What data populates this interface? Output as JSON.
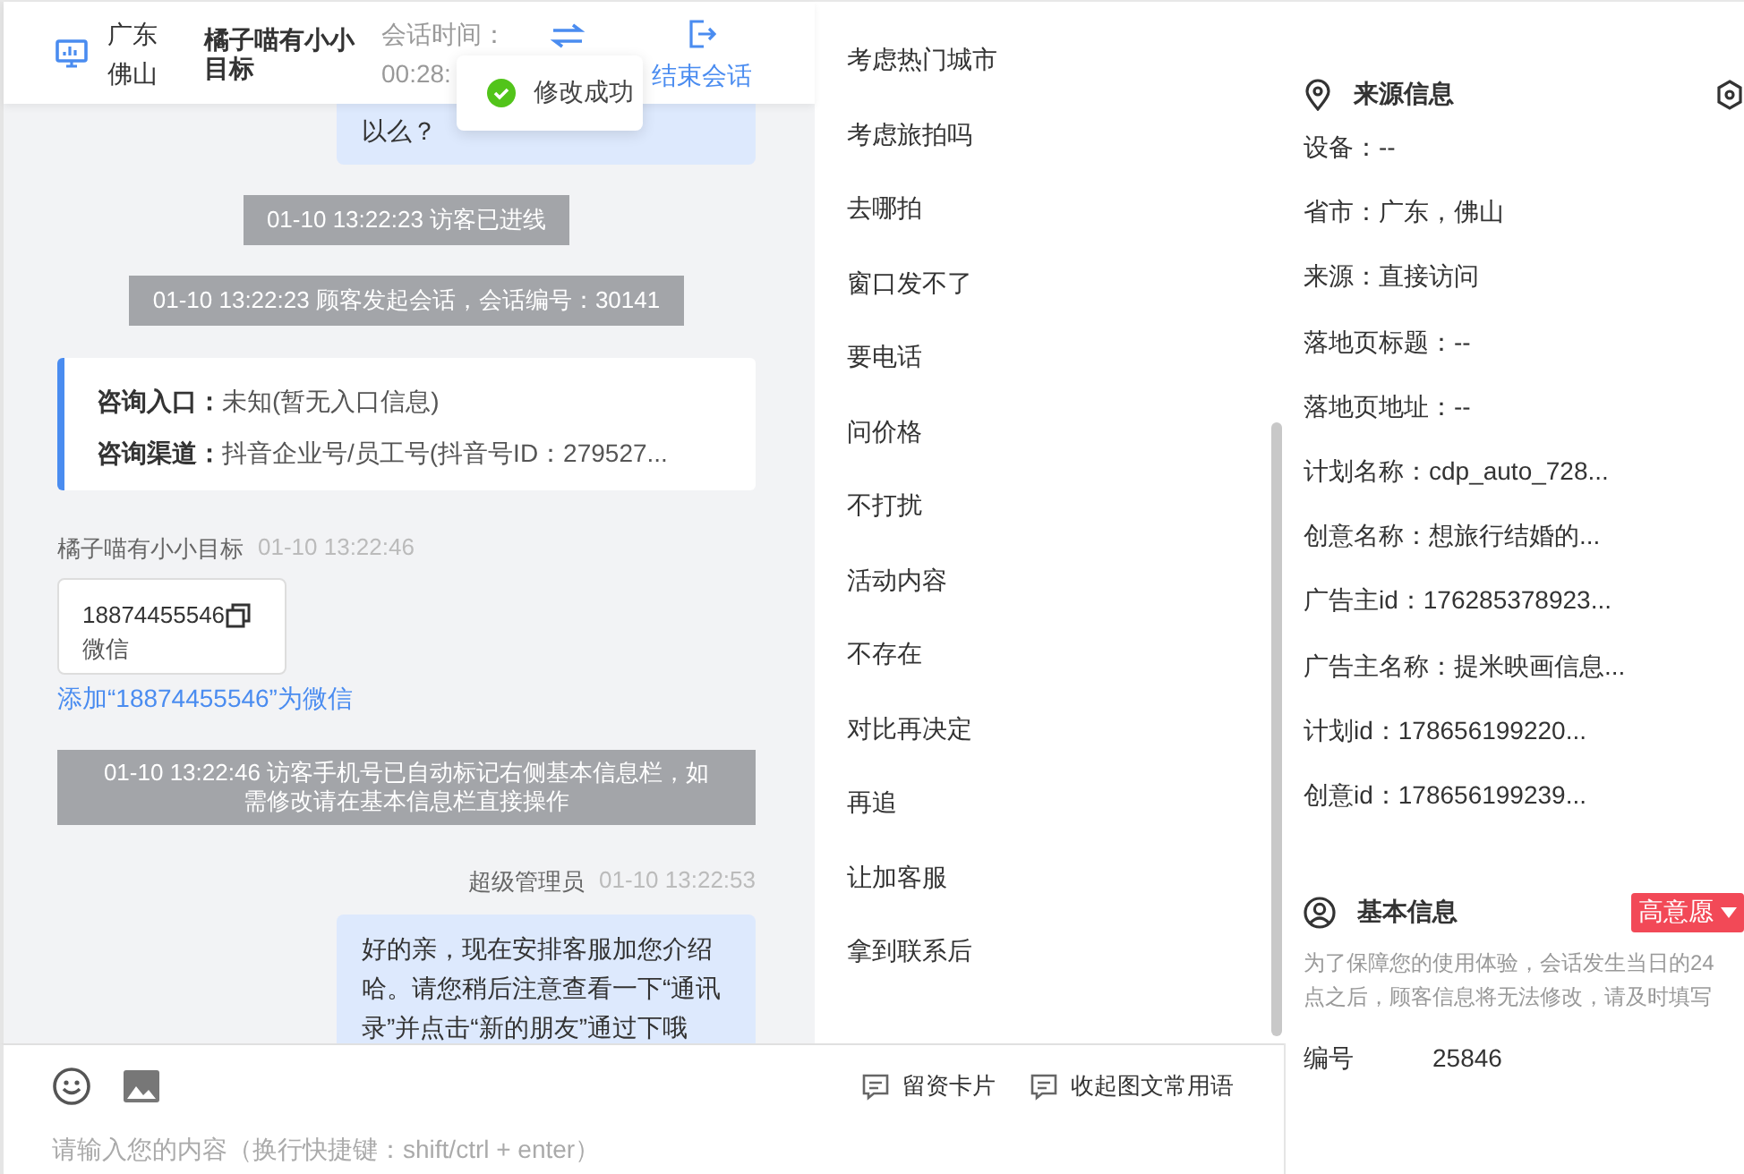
{
  "header": {
    "location": [
      "广东",
      "佛山"
    ],
    "visitor_name": "橘子喵有小小目标",
    "session_time_label": "会话时间：",
    "session_time": "00:28:",
    "end_button": "结束会话"
  },
  "toast": {
    "kind": "success",
    "text": "修改成功"
  },
  "messages": [
    {
      "kind": "bubble",
      "text": "以么？"
    },
    {
      "kind": "system",
      "text": "01-10 13:22:23 访客已进线"
    },
    {
      "kind": "system",
      "text": "01-10 13:22:23 顾客发起会话，会话编号：30141"
    },
    {
      "kind": "info_card",
      "rows": [
        {
          "label": "咨询入口：",
          "value": "未知(暂无入口信息)"
        },
        {
          "label": "咨询渠道：",
          "value": "抖音企业号/员工号(抖音号ID：279527..."
        }
      ]
    },
    {
      "kind": "visitor_meta",
      "sender": "橘子喵有小小目标",
      "time": "01-10 13:22:46"
    },
    {
      "kind": "contact_card",
      "number": "18874455546",
      "type": "微信"
    },
    {
      "kind": "link",
      "text": "添加“18874455546”为微信"
    },
    {
      "kind": "notice",
      "text": "01-10 13:22:46 访客手机号已自动标记右侧基本信息栏，如需修改请在基本信息栏直接操作"
    },
    {
      "kind": "agent_meta",
      "sender": "超级管理员",
      "time": "01-10 13:22:53"
    },
    {
      "kind": "bubble",
      "text": "好的亲，现在安排客服加您介绍哈。请您稍后注意查看一下“通讯录”并点击“新的朋友”通过下哦"
    }
  ],
  "composer": {
    "tools": [
      "留资卡片",
      "收起图文常用语"
    ],
    "placeholder": "请输入您的内容（换行快捷键：shift/ctrl + enter）"
  },
  "quick_replies": [
    "考虑热门城市",
    "考虑旅拍吗",
    "去哪拍",
    "窗口发不了",
    "要电话",
    "问价格",
    "不打扰",
    "活动内容",
    "不存在",
    "对比再决定",
    "再追",
    "让加客服",
    "拿到联系后"
  ],
  "source_info": {
    "title": "来源信息",
    "fields": [
      "设备：--",
      "省市：广东，佛山",
      "来源：直接访问",
      "落地页标题：--",
      "落地页地址：--",
      "计划名称：cdp_auto_728...",
      "创意名称：想旅行结婚的...",
      "广告主id：176285378923...",
      "广告主名称：提米映画信息...",
      "计划id：178656199220...",
      "创意id：178656199239..."
    ]
  },
  "basic_info": {
    "title": "基本信息",
    "intent_tag": "高意愿",
    "notice": "为了保障您的使用体验，会话发生当日的24点之后，顾客信息将无法修改，请及时填写",
    "fields": [
      {
        "label": "编号",
        "value": "25846"
      }
    ]
  }
}
